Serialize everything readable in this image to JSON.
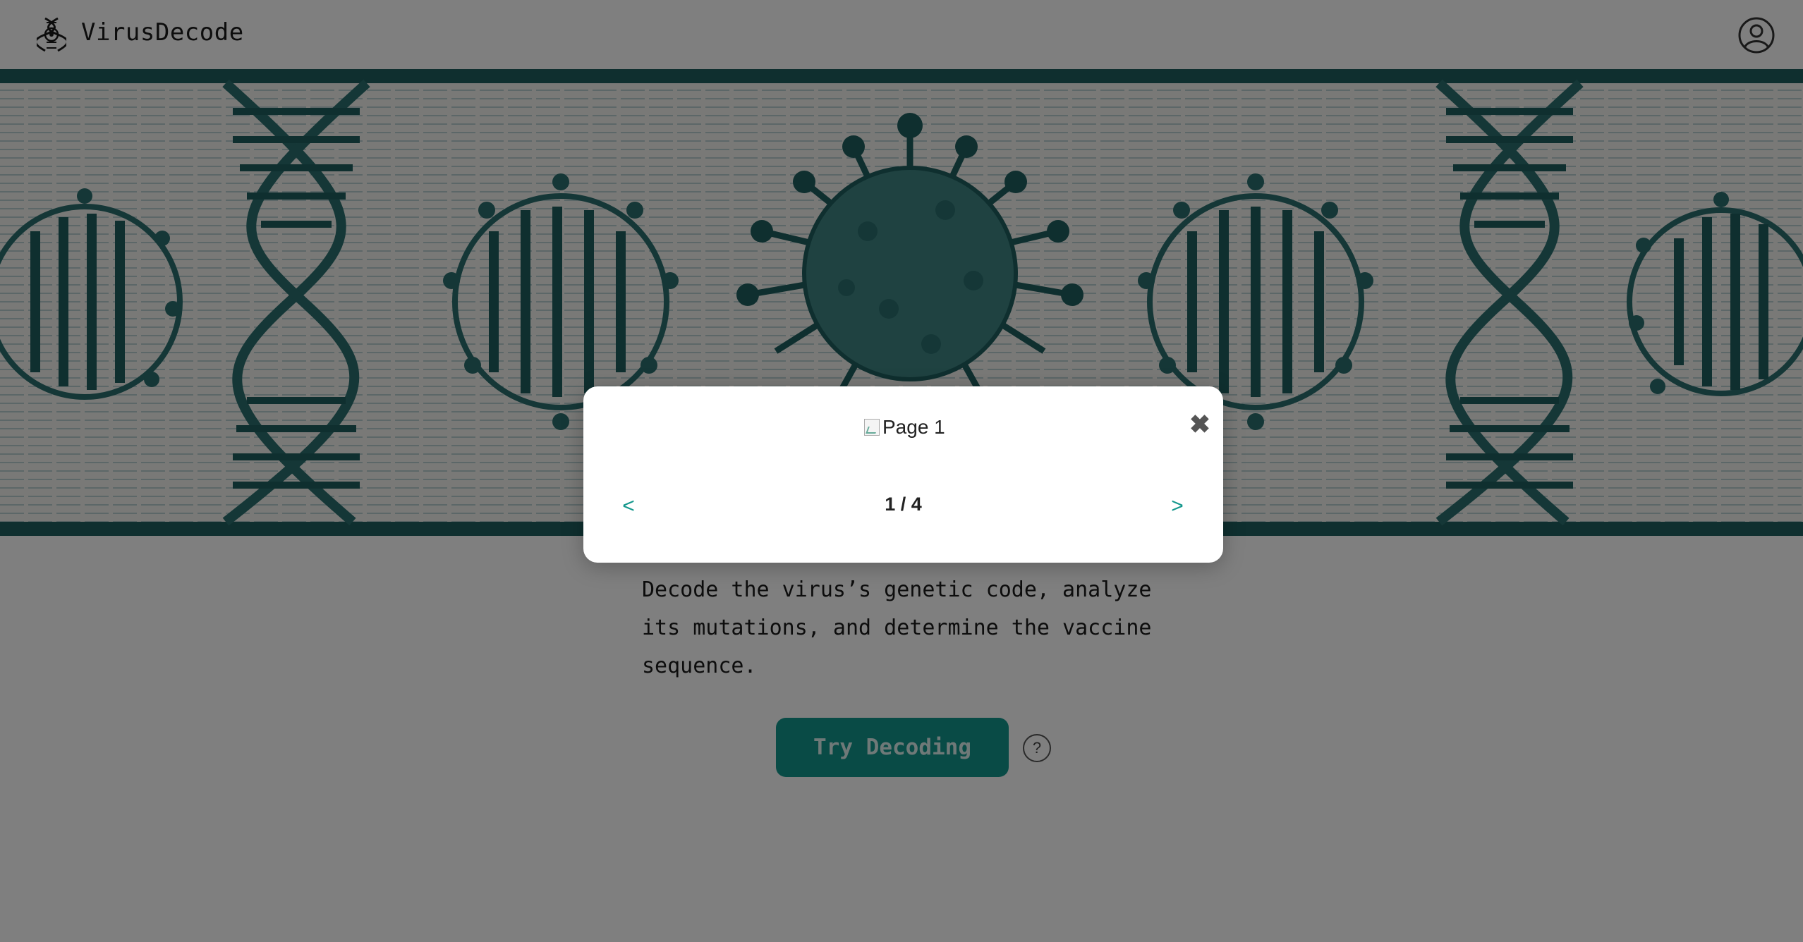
{
  "header": {
    "brand": "VirusDecode",
    "logo_icon": "dna-virus-logo-icon",
    "profile_icon": "user-profile-icon"
  },
  "banner": {
    "description": "DNA helix and virus illustration banner"
  },
  "main": {
    "description": "Decode the virus’s genetic code, analyze its mutations, and determine the vaccine sequence.",
    "try_button": "Try Decoding",
    "help_button": "?"
  },
  "modal": {
    "image_alt": "Page 1",
    "close_label": "✖",
    "prev_label": "<",
    "next_label": ">",
    "counter": "1 / 4"
  },
  "colors": {
    "accent": "#13978c",
    "banner_dark": "#1f5f5e",
    "overlay": "rgba(0,0,0,0.5)"
  }
}
